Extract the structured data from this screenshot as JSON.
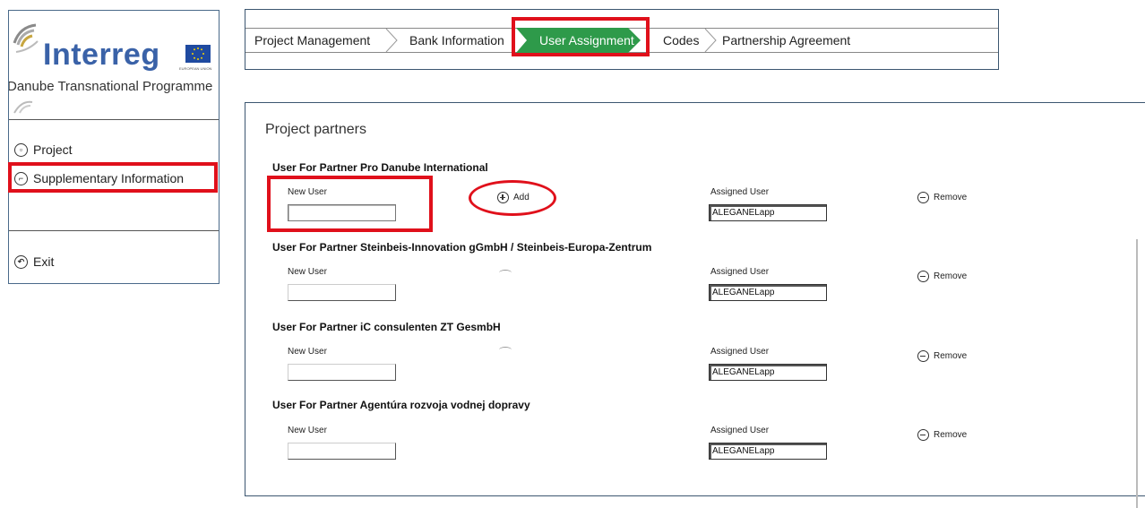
{
  "sidebar": {
    "logo": {
      "brand": "Interreg",
      "programme": "Danube Transnational Programme",
      "flag_caption": "EUROPEAN UNION"
    },
    "items": [
      {
        "label": "Project",
        "icon": "document-icon"
      },
      {
        "label": "Supplementary Information",
        "icon": "info-icon"
      }
    ],
    "exit_label": "Exit"
  },
  "breadcrumb": {
    "steps": [
      {
        "label": "Project Management"
      },
      {
        "label": "Bank Information"
      },
      {
        "label": "User Assignment",
        "active": true
      },
      {
        "label": "Codes"
      },
      {
        "label": "Partnership Agreement"
      }
    ]
  },
  "panel": {
    "title": "Project partners",
    "new_user_label": "New User",
    "assigned_user_label": "Assigned User",
    "add_label": "Add",
    "remove_label": "Remove",
    "partners": [
      {
        "title": "User For Partner Pro Danube International",
        "assigned_user": "ALEGANELapp"
      },
      {
        "title": "User For Partner Steinbeis-Innovation gGmbH / Steinbeis-Europa-Zentrum",
        "assigned_user": "ALEGANELapp"
      },
      {
        "title": "User For Partner iC consulenten ZT GesmbH",
        "assigned_user": "ALEGANELapp"
      },
      {
        "title": "User For Partner Agentúra rozvoja vodnej dopravy",
        "assigned_user": "ALEGANELapp"
      }
    ]
  },
  "colors": {
    "active_step": "#2e9a4a",
    "highlight": "#e0101b",
    "brand_blue": "#3a62a8"
  }
}
